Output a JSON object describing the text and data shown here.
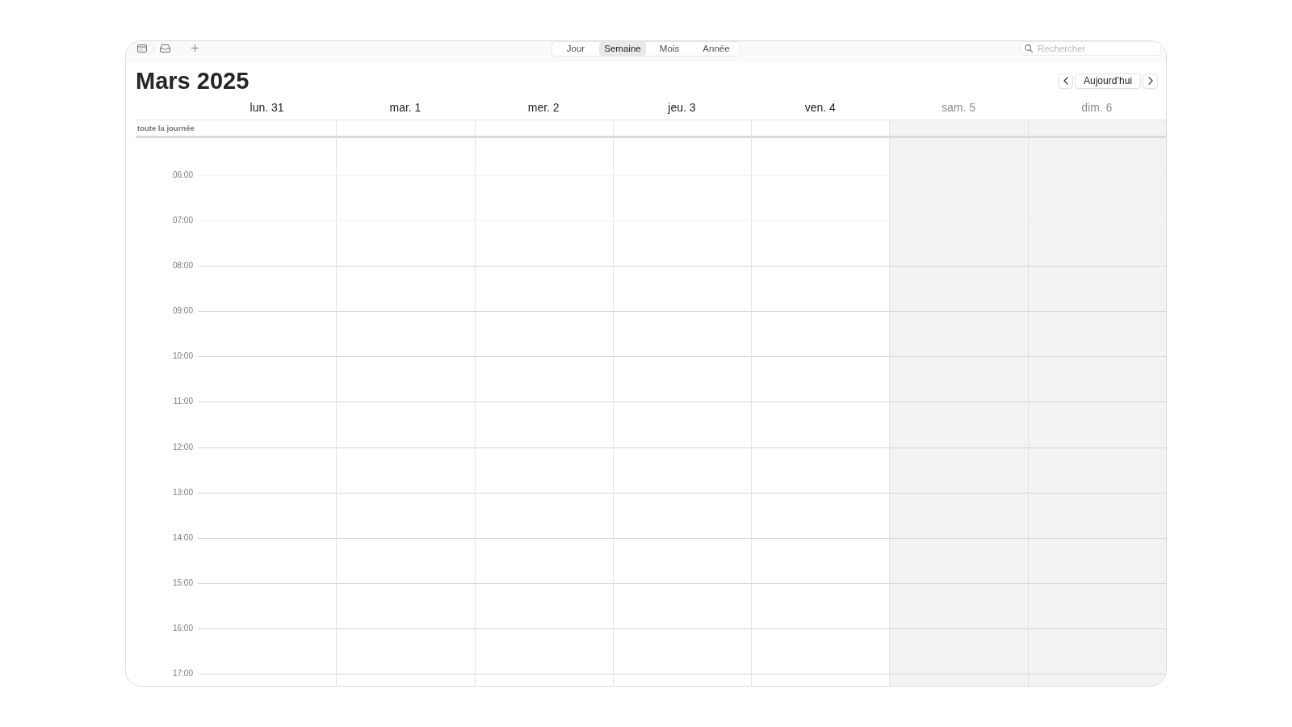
{
  "toolbar": {
    "view_tabs": [
      {
        "label": "Jour",
        "selected": false
      },
      {
        "label": "Semaine",
        "selected": true
      },
      {
        "label": "Mois",
        "selected": false
      },
      {
        "label": "Année",
        "selected": false
      }
    ],
    "search": {
      "placeholder": "Rechercher"
    }
  },
  "header": {
    "title": "Mars 2025",
    "today_button": "Aujourd’hui"
  },
  "days": [
    {
      "label": "lun. 31",
      "weekend": false
    },
    {
      "label": "mar. 1",
      "weekend": false
    },
    {
      "label": "mer. 2",
      "weekend": false
    },
    {
      "label": "jeu. 3",
      "weekend": false
    },
    {
      "label": "ven. 4",
      "weekend": false
    },
    {
      "label": "sam. 5",
      "weekend": true
    },
    {
      "label": "dim. 6",
      "weekend": true
    }
  ],
  "all_day_label": "toute la journée",
  "hours": [
    {
      "label": "06:00",
      "off_hours": true
    },
    {
      "label": "07:00",
      "off_hours": true
    },
    {
      "label": "08:00",
      "off_hours": false
    },
    {
      "label": "09:00",
      "off_hours": false
    },
    {
      "label": "10:00",
      "off_hours": false
    },
    {
      "label": "11:00",
      "off_hours": false
    },
    {
      "label": "12:00",
      "off_hours": false
    },
    {
      "label": "13:00",
      "off_hours": false
    },
    {
      "label": "14:00",
      "off_hours": false
    },
    {
      "label": "15:00",
      "off_hours": false
    },
    {
      "label": "16:00",
      "off_hours": false
    },
    {
      "label": "17:00",
      "off_hours": false
    }
  ]
}
